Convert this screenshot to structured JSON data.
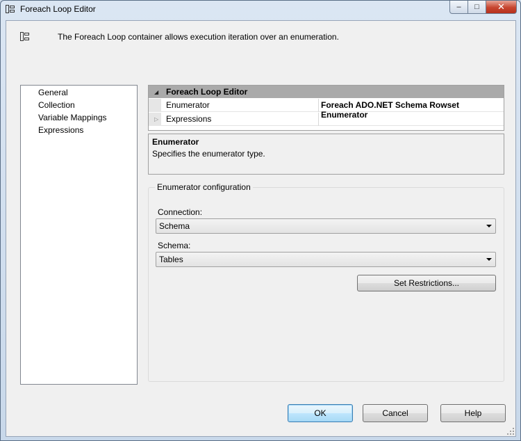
{
  "window": {
    "title": "Foreach Loop Editor",
    "close_glyph": "✕",
    "maximize_glyph": "□",
    "minimize_glyph": "–"
  },
  "header": {
    "description": "The Foreach Loop container allows execution iteration over an enumeration."
  },
  "nav": {
    "items": [
      {
        "label": "General"
      },
      {
        "label": "Collection"
      },
      {
        "label": "Variable Mappings"
      },
      {
        "label": "Expressions"
      }
    ],
    "selected": "Collection"
  },
  "property_grid": {
    "category": "Foreach Loop Editor",
    "rows": [
      {
        "name": "Enumerator",
        "value": "Foreach ADO.NET Schema Rowset Enumerator"
      },
      {
        "name": "Expressions",
        "value": ""
      }
    ]
  },
  "description_pane": {
    "title": "Enumerator",
    "text": "Specifies the enumerator type."
  },
  "enumerator_config": {
    "group_title": "Enumerator configuration",
    "connection_label": "Connection:",
    "connection_value": "Schema",
    "schema_label": "Schema:",
    "schema_value": "Tables",
    "set_restrictions_label": "Set Restrictions..."
  },
  "footer": {
    "ok_label": "OK",
    "cancel_label": "Cancel",
    "help_label": "Help"
  },
  "icons": {
    "title": "foreach-loop-icon",
    "header": "foreach-loop-icon",
    "category_expander": "collapse-triangle-icon",
    "row_expander": "expand-triangle-icon",
    "combo_arrow": "chevron-down-icon"
  }
}
